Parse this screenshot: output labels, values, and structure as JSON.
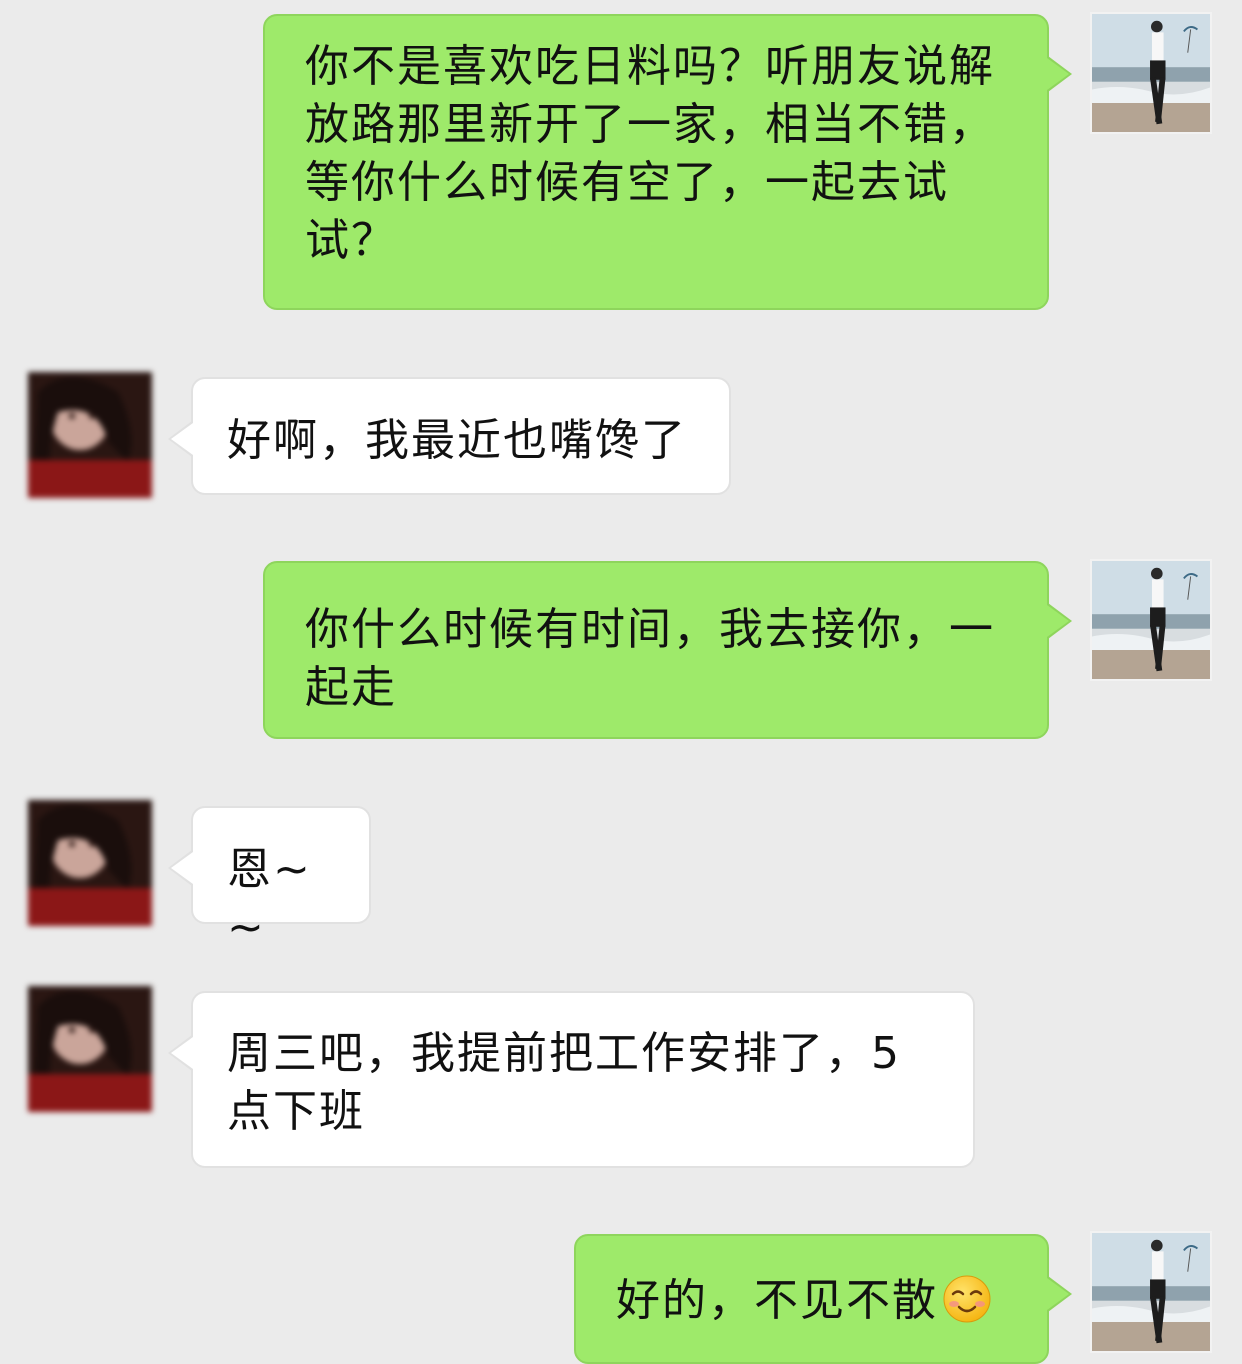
{
  "conversation": {
    "messages": [
      {
        "sender": "self",
        "text": "你不是喜欢吃日料吗？听朋友说解放路那里新开了一家，相当不错，等你什么时候有空了，一起去试试？"
      },
      {
        "sender": "other",
        "text": "好啊，我最近也嘴馋了"
      },
      {
        "sender": "self",
        "text": "你什么时候有时间，我去接你，一起走"
      },
      {
        "sender": "other",
        "text": "恩~ ~"
      },
      {
        "sender": "other",
        "text": "周三吧，我提前把工作安排了，5点下班"
      },
      {
        "sender": "self",
        "text": "好的，不见不散",
        "emoji": "blushing-smile-emoji"
      }
    ]
  },
  "icons": {
    "self_avatar": "self-avatar-photo",
    "other_avatar": "contact-avatar-photo-blurred",
    "emoji": "blushing-smile-emoji"
  },
  "colors": {
    "background": "#ebebeb",
    "self_bubble": "#9eea6a",
    "other_bubble": "#ffffff"
  }
}
